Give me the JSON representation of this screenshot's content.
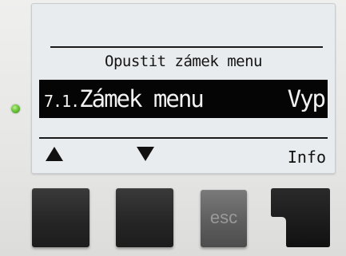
{
  "lcd": {
    "title": "Opustit zámek menu",
    "selected_row": {
      "number": "7.1.",
      "label": "Zámek menu",
      "value": "Vyp"
    },
    "softkeys": {
      "left_icon": "up-arrow-icon",
      "middle_icon": "down-arrow-icon",
      "right_label": "Info"
    }
  },
  "buttons": {
    "esc_label": "esc"
  },
  "colors": {
    "lcd_background": "#e9ecee",
    "highlight": "#050505",
    "led": "#6cc63c"
  }
}
